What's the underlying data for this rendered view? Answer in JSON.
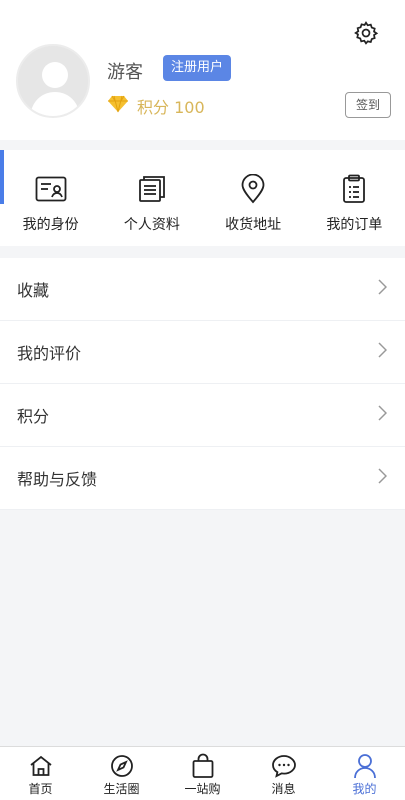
{
  "profile": {
    "username": "游客",
    "badge": "注册用户",
    "points": "积分 100",
    "checkin": "签到"
  },
  "quick": [
    {
      "label": "我的身份",
      "icon": "id-card-icon"
    },
    {
      "label": "个人资料",
      "icon": "document-icon"
    },
    {
      "label": "收货地址",
      "icon": "location-pin-icon"
    },
    {
      "label": "我的订单",
      "icon": "clipboard-icon"
    }
  ],
  "menu": [
    {
      "label": "收藏"
    },
    {
      "label": "我的评价"
    },
    {
      "label": "积分"
    },
    {
      "label": "帮助与反馈"
    }
  ],
  "tabs": [
    {
      "label": "首页",
      "icon": "home-icon"
    },
    {
      "label": "生活圈",
      "icon": "compass-icon"
    },
    {
      "label": "一站购",
      "icon": "shopping-bag-icon"
    },
    {
      "label": "消息",
      "icon": "chat-bubble-icon"
    },
    {
      "label": "我的",
      "icon": "user-icon",
      "active": true
    }
  ],
  "colors": {
    "accent": "#5b86e5",
    "active_tab": "#4a6fd6",
    "points_gold": "#d8b65a"
  }
}
